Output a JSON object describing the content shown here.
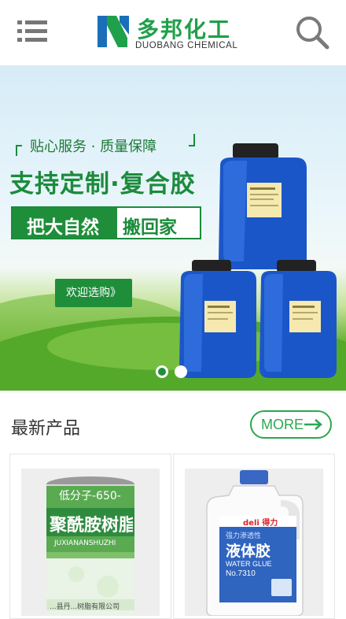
{
  "header": {
    "menu_icon": "hamburger-menu-icon",
    "logo_cn": "多邦化工",
    "logo_en": "DUOBANG CHEMICAL",
    "search_icon": "search-icon",
    "brand_color": "#1fa04a"
  },
  "banner": {
    "tagline": "贴心服务 · 质量保障",
    "headline": "支持定制·复合胶",
    "slogan_left": "把大自然",
    "slogan_right": "搬回家",
    "cta_label": "欢迎选购》",
    "slides": 2,
    "active_slide": 1,
    "accent": "#1f8e3a"
  },
  "section": {
    "title": "最新产品",
    "more_label": "MORE",
    "accent": "#2aa84f"
  },
  "products": [
    {
      "can_line1": "低分子-650-",
      "can_line2": "聚酰胺树脂",
      "can_line3": "JUXIANANSHUZHI",
      "can_line4": "...县丹...树脂有限公司"
    },
    {
      "brand": "deli 得力",
      "line1": "强力渗透性",
      "line2": "液体胶",
      "line3": "WATER GLUE",
      "line4": "No.7310"
    }
  ]
}
